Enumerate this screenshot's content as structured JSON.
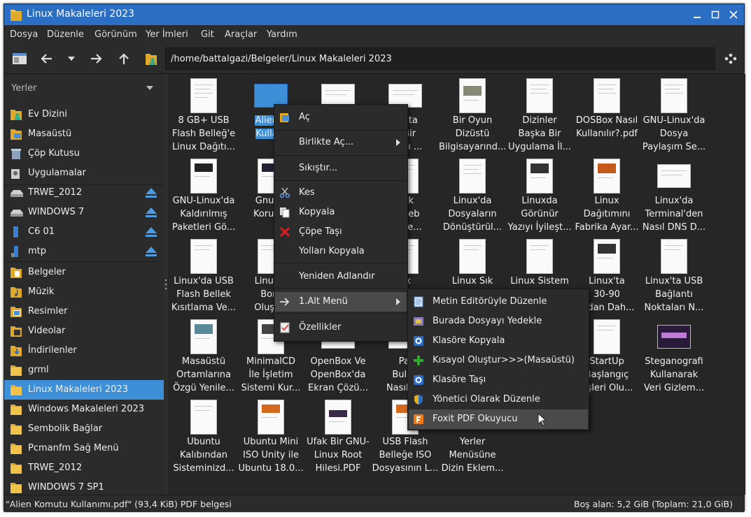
{
  "window": {
    "title": "Linux Makaleleri 2023"
  },
  "menubar": [
    "Dosya",
    "Düzenle",
    "Görünüm",
    "Yer İmleri",
    "Git",
    "Araçlar",
    "Yardım"
  ],
  "toolbar": {
    "path": "/home/battalgazi/Belgeler/Linux Makaleleri 2023"
  },
  "sidebar": {
    "header": "Yerler",
    "places": [
      "Ev Dizini",
      "Masaüstü",
      "Çöp Kutusu",
      "Uygulamalar"
    ],
    "devices": [
      "TRWE_2012",
      "WINDOWS 7",
      "C6 01",
      "mtp"
    ],
    "bookmarks": [
      "Belgeler",
      "Müzik",
      "Resimler",
      "Videolar",
      "İndirilenler",
      "grml",
      "Linux Makaleleri 2023",
      "Windows Makaleleri 2023",
      "Sembolik Bağlar",
      "Pcmanfm Sağ Menü",
      "TRWE_2012",
      "WINDOWS 7 SP1"
    ]
  },
  "files": [
    [
      "8 GB+ USB\nFlash Belleğ'e\nLinux Dağıtı...",
      "Alien K\nKullanı",
      "",
      "ığıçta\nn Bir\nmayı ...",
      "Bir Oyun\nDizüstü\nBilgisayarınd...",
      "Dizinler\nBaşka Bir\nUygulama İl...",
      "DOSBox Nasıl\nKullanılır?.pdf",
      "GNU-Linux'da\nDosya\nPaylaşım Se..."
    ],
    [
      "GNU-Linux'da\nKaldırılmış\nPaketleri Gö...",
      "GnuPG\nKoruma",
      "",
      "nak\nn .deb\nDerle...",
      "Linux'da\nDosyaların\nDönüştürül...",
      "Linuxda\nGörünür\nYazıyı İyileşt...",
      "Linux\nDağıtımını\nFabrika Ayar...",
      "Linux'da\nTerminal'den\nNasıl DNS D..."
    ],
    [
      "Linux'da USB\nFlash Bellek\nKısıtlama Ve...",
      "Linux'd\nBom\nOluştur",
      "",
      "ux",
      "Linux Sık",
      "Linux Sistem",
      "Linux'ta\n30-90\nından Dah...",
      "Linux'ta USB\nBağlantı\nNoktaları N..."
    ],
    [
      "Masaüstü\nOrtamlarına\nÖzgü Yenile...",
      "MinimalCD\nİle İşletim\nSistemi Kur...",
      "OpenBox Ve\nOpenBox'da\nEkran Çözü...",
      "Pal\nBulun\nNasıl Du",
      "",
      "",
      "StartUp\nBaşlangıç\nrişleri Olu...",
      "Steganografi\nKullanarak\nVeri Gizlem..."
    ],
    [
      "Ubuntu\nKalıbından\nSisteminizd...",
      "Ubuntu Mini\nISO Unity ile\nUbuntu 18.0...",
      "Ufak Bir GNU-\nLinux Root\nHilesi.PDF",
      "USB Flash\nBelleğe ISO\nDosyasının L...",
      "Yerler\nMenüsüne\nDizin Eklem...",
      "",
      "",
      ""
    ]
  ],
  "context_menu": [
    "Aç",
    "Birlikte Aç...",
    "Sıkıştır...",
    "Kes",
    "Kopyala",
    "Çöpe Taşı",
    "Yolları Kopyala",
    "Yeniden Adlandır",
    "1.Alt Menü",
    "Özellikler"
  ],
  "submenu": [
    "Metin Editörüyle Düzenle",
    "Burada Dosyayı Yedekle",
    "Klasöre Kopyala",
    "Kısayol Oluştur>>>(Masaüstü)",
    "Klasöre Taşı",
    "Yönetici Olarak Düzenle",
    "Foxit PDF Okuyucu"
  ],
  "status": {
    "left": "\"Alien Komutu Kullanımı.pdf\" (93,4 KiB) PDF belgesi",
    "right": "Boş alan: 5,2 GiB (Toplam: 21,0 GiB)"
  }
}
